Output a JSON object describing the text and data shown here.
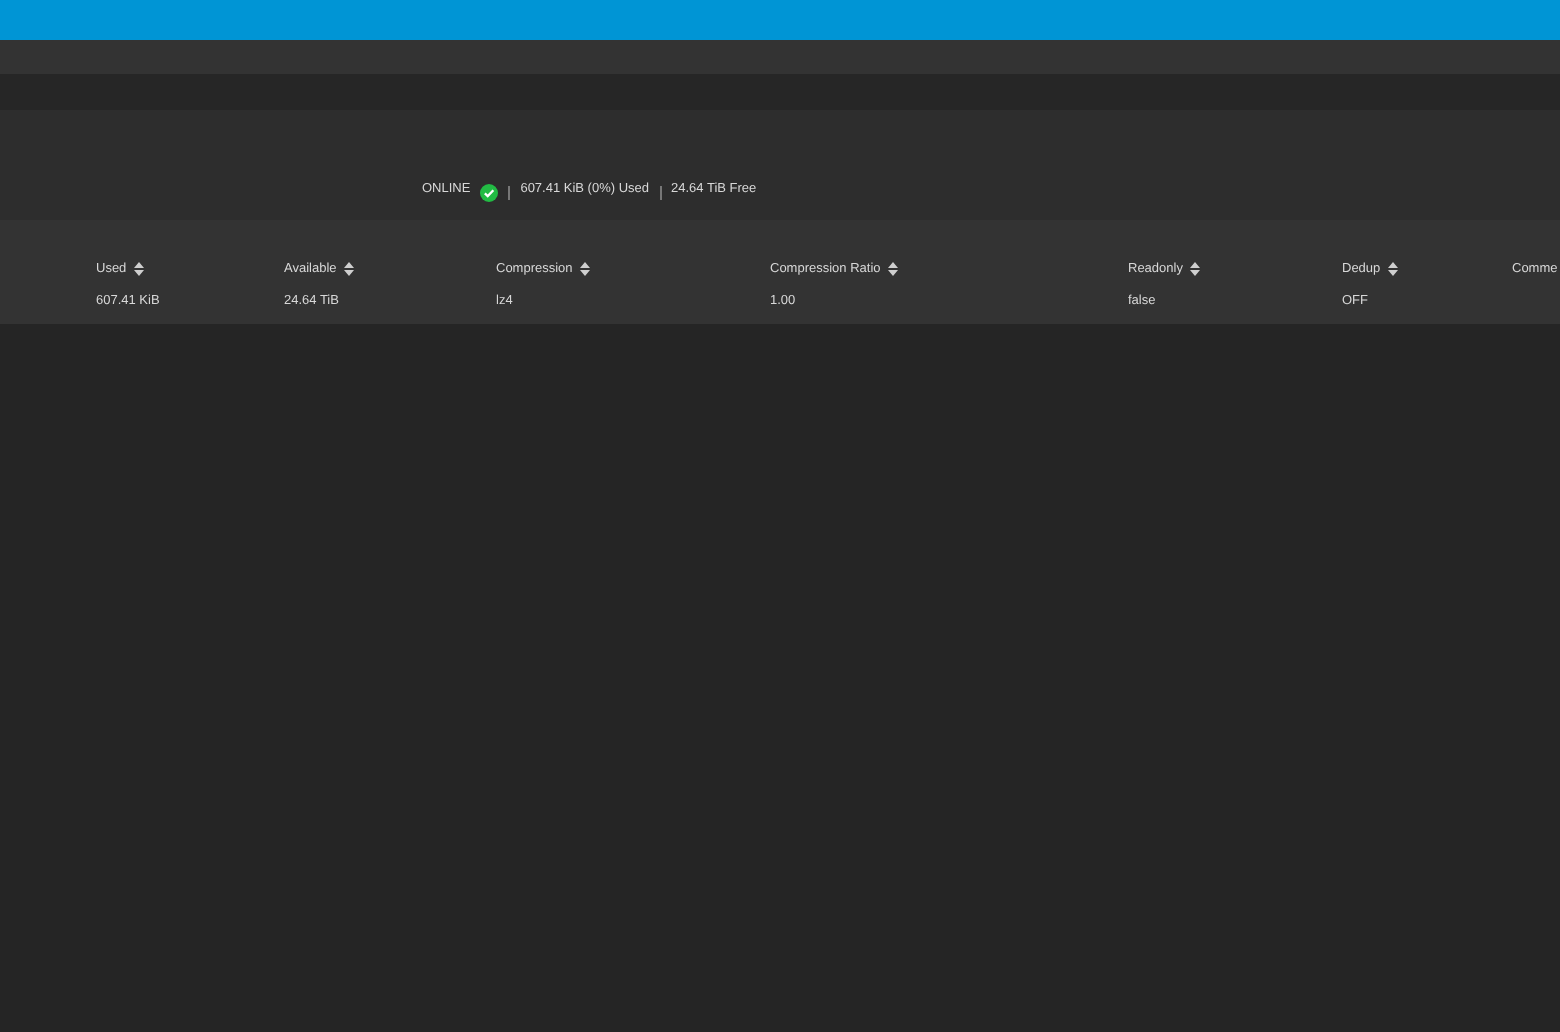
{
  "pool_status": {
    "state": "ONLINE",
    "healthy": true,
    "used": "607.41 KiB (0%) Used",
    "free": "24.64 TiB Free"
  },
  "table": {
    "columns": [
      {
        "label": "Used",
        "sortable": true
      },
      {
        "label": "Available",
        "sortable": true
      },
      {
        "label": "Compression",
        "sortable": true
      },
      {
        "label": "Compression Ratio",
        "sortable": true
      },
      {
        "label": "Readonly",
        "sortable": true
      },
      {
        "label": "Dedup",
        "sortable": true
      },
      {
        "label": "Comme",
        "sortable": false
      }
    ],
    "rows": [
      [
        "607.41 KiB",
        "24.64 TiB",
        "lz4",
        "1.00",
        "false",
        "OFF"
      ]
    ]
  }
}
